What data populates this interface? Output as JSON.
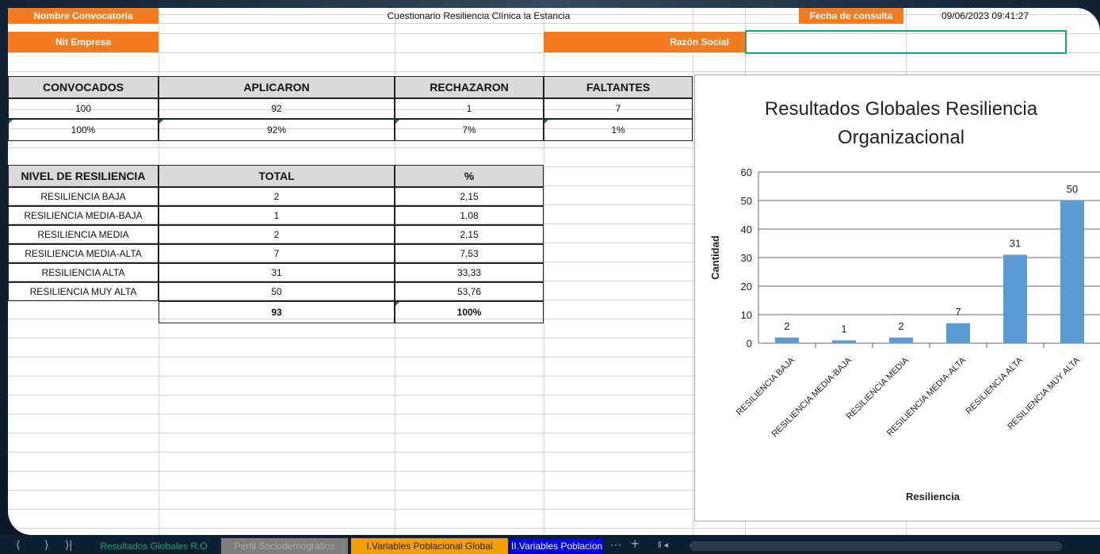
{
  "header": {
    "convocatoria_label": "Nombre Convocatoria",
    "convocatoria_value": "Cuestionario Resiliencia Clínica la Estancia",
    "fecha_label": "Fecha de consulta",
    "fecha_value": "09/06/2023 09:41:27",
    "nit_label": "Nit Empresa",
    "razon_label": "Razón Social"
  },
  "summary": {
    "headers": [
      "CONVOCADOS",
      "APLICARON",
      "RECHAZARON",
      "FALTANTES"
    ],
    "row_counts": [
      "100",
      "92",
      "1",
      "7"
    ],
    "row_percent": [
      "100%",
      "92%",
      "7%",
      "1%"
    ]
  },
  "levels": {
    "headers": [
      "NIVEL DE RESILIENCIA",
      "TOTAL",
      "%"
    ],
    "rows": [
      [
        "RESILIENCIA BAJA",
        "2",
        "2,15"
      ],
      [
        "RESILIENCIA MEDIA-BAJA",
        "1",
        "1,08"
      ],
      [
        "RESILIENCIA MEDIA",
        "2",
        "2,15"
      ],
      [
        "RESILIENCIA MEDIA-ALTA",
        "7",
        "7,53"
      ],
      [
        "RESILIENCIA ALTA",
        "31",
        "33,33"
      ],
      [
        "RESILIENCIA MUY ALTA",
        "50",
        "53,76"
      ]
    ],
    "total_row": [
      "",
      "93",
      "100%"
    ]
  },
  "chart_data": {
    "type": "bar",
    "title": "Resultados Globales Resiliencia Organizacional",
    "title_lines": [
      "Resultados Globales Resiliencia",
      "Organizacional"
    ],
    "categories": [
      "RESILIENCIA BAJA",
      "RESILIENCIA MEDIA-BAJA",
      "RESILIENCIA MEDIA",
      "RESILIENCIA MEDIA-ALTA",
      "RESILIENCIA ALTA",
      "RESILIENCIA MUY ALTA"
    ],
    "values": [
      2,
      1,
      2,
      7,
      31,
      50
    ],
    "xlabel": "Resiliencia",
    "ylabel": "Cantidad",
    "ylim": [
      0,
      60
    ],
    "yticks": [
      0,
      10,
      20,
      30,
      40,
      50,
      60
    ],
    "bar_color": "#5b9bd5",
    "grid": true
  },
  "tabs": [
    {
      "label": "Resultados Globales R.O",
      "color": "#0d1f33",
      "text_color": "#21a366"
    },
    {
      "label": "Perfil Sociodemográfico",
      "color": "#7f7f7f",
      "text_color": "#a8a8a8"
    },
    {
      "label": "I.Variables Poblacional Global",
      "color": "#f4a000",
      "text_color": "#1d1d1d"
    },
    {
      "label": "II.Variables Poblacion",
      "color": "#0000e0",
      "text_color": "#ffffff"
    }
  ],
  "icons": [
    "first-sheet-icon",
    "prev-sheet-icon",
    "next-sheet-icon",
    "last-sheet-icon",
    "more-sheets-icon",
    "add-sheet-icon"
  ]
}
